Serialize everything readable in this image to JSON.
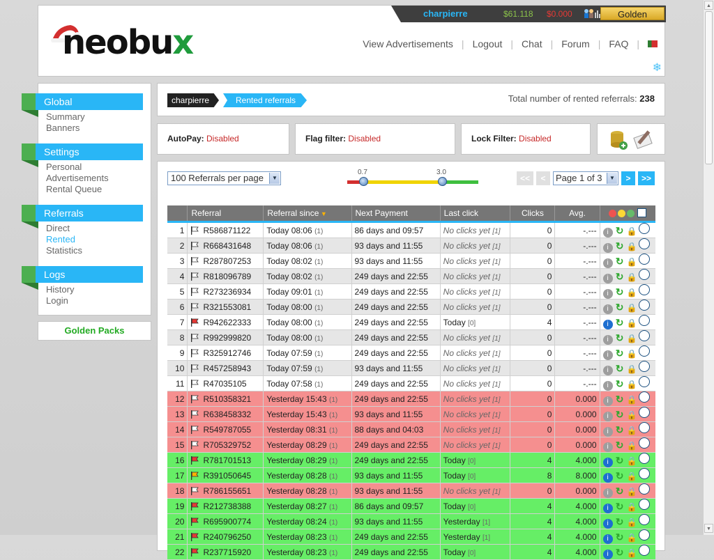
{
  "header": {
    "logo_text": "neobux",
    "username": "charpierre",
    "balance_main": "$61.118",
    "balance_rental": "$0.000",
    "membership_button": "Golden",
    "nav": [
      "View Advertisements",
      "Logout",
      "Chat",
      "Forum",
      "FAQ"
    ]
  },
  "sidebar": {
    "sections": [
      {
        "title": "Global",
        "links": [
          {
            "label": "Summary"
          },
          {
            "label": "Banners"
          }
        ]
      },
      {
        "title": "Settings",
        "links": [
          {
            "label": "Personal"
          },
          {
            "label": "Advertisements"
          },
          {
            "label": "Rental Queue"
          }
        ]
      },
      {
        "title": "Referrals",
        "links": [
          {
            "label": "Direct"
          },
          {
            "label": "Rented",
            "active": true
          },
          {
            "label": "Statistics"
          }
        ]
      },
      {
        "title": "Logs",
        "links": [
          {
            "label": "History"
          },
          {
            "label": "Login"
          }
        ]
      }
    ],
    "golden_packs": "Golden Packs"
  },
  "breadcrumb": {
    "user": "charpierre",
    "page": "Rented referrals"
  },
  "total": {
    "label": "Total number of rented referrals:",
    "value": "238"
  },
  "filters": {
    "autopay": {
      "label": "AutoPay:",
      "value": "Disabled"
    },
    "flag": {
      "label": "Flag filter:",
      "value": "Disabled"
    },
    "lock": {
      "label": "Lock Filter:",
      "value": "Disabled"
    }
  },
  "controls": {
    "per_page": "100 Referrals per page",
    "slider_min": "0.7",
    "slider_max": "3.0",
    "page_select": "Page 1 of 3",
    "first": "<<",
    "prev": "<",
    "next": ">",
    "last": ">>"
  },
  "table": {
    "columns": [
      "Referral",
      "Referral since",
      "Next Payment",
      "Last click",
      "Clicks",
      "Avg."
    ],
    "rows": [
      {
        "n": "1",
        "id": "R586871122",
        "since": "Today 08:06",
        "since_n": "(1)",
        "next": "86 days and 09:57",
        "last": "No clicks yet",
        "last_n": "[1]",
        "clicks": "0",
        "avg": "-.---",
        "color": "white",
        "flag": "white",
        "info": "gray"
      },
      {
        "n": "2",
        "id": "R668431648",
        "since": "Today 08:06",
        "since_n": "(1)",
        "next": "93 days and 11:55",
        "last": "No clicks yet",
        "last_n": "[1]",
        "clicks": "0",
        "avg": "-.---",
        "color": "gray",
        "flag": "white",
        "info": "gray"
      },
      {
        "n": "3",
        "id": "R287807253",
        "since": "Today 08:02",
        "since_n": "(1)",
        "next": "93 days and 11:55",
        "last": "No clicks yet",
        "last_n": "[1]",
        "clicks": "0",
        "avg": "-.---",
        "color": "white",
        "flag": "white",
        "info": "gray"
      },
      {
        "n": "4",
        "id": "R818096789",
        "since": "Today 08:02",
        "since_n": "(1)",
        "next": "249 days and 22:55",
        "last": "No clicks yet",
        "last_n": "[1]",
        "clicks": "0",
        "avg": "-.---",
        "color": "gray",
        "flag": "white",
        "info": "gray"
      },
      {
        "n": "5",
        "id": "R273236934",
        "since": "Today 09:01",
        "since_n": "(1)",
        "next": "249 days and 22:55",
        "last": "No clicks yet",
        "last_n": "[1]",
        "clicks": "0",
        "avg": "-.---",
        "color": "white",
        "flag": "white",
        "info": "gray"
      },
      {
        "n": "6",
        "id": "R321553081",
        "since": "Today 08:00",
        "since_n": "(1)",
        "next": "249 days and 22:55",
        "last": "No clicks yet",
        "last_n": "[1]",
        "clicks": "0",
        "avg": "-.---",
        "color": "gray",
        "flag": "white",
        "info": "gray"
      },
      {
        "n": "7",
        "id": "R942622333",
        "since": "Today 08:00",
        "since_n": "(1)",
        "next": "249 days and 22:55",
        "last": "Today",
        "last_n": "[0]",
        "clicks": "4",
        "avg": "-.---",
        "color": "white",
        "flag": "red",
        "info": "blue"
      },
      {
        "n": "8",
        "id": "R992999820",
        "since": "Today 08:00",
        "since_n": "(1)",
        "next": "249 days and 22:55",
        "last": "No clicks yet",
        "last_n": "[1]",
        "clicks": "0",
        "avg": "-.---",
        "color": "gray",
        "flag": "white",
        "info": "gray"
      },
      {
        "n": "9",
        "id": "R325912746",
        "since": "Today 07:59",
        "since_n": "(1)",
        "next": "249 days and 22:55",
        "last": "No clicks yet",
        "last_n": "[1]",
        "clicks": "0",
        "avg": "-.---",
        "color": "white",
        "flag": "white",
        "info": "gray"
      },
      {
        "n": "10",
        "id": "R457258943",
        "since": "Today 07:59",
        "since_n": "(1)",
        "next": "93 days and 11:55",
        "last": "No clicks yet",
        "last_n": "[1]",
        "clicks": "0",
        "avg": "-.---",
        "color": "gray",
        "flag": "white",
        "info": "gray"
      },
      {
        "n": "11",
        "id": "R47035105",
        "since": "Today 07:58",
        "since_n": "(1)",
        "next": "249 days and 22:55",
        "last": "No clicks yet",
        "last_n": "[1]",
        "clicks": "0",
        "avg": "-.---",
        "color": "white",
        "flag": "white",
        "info": "gray"
      },
      {
        "n": "12",
        "id": "R510358321",
        "since": "Yesterday 15:43",
        "since_n": "(1)",
        "next": "249 days and 22:55",
        "last": "No clicks yet",
        "last_n": "[1]",
        "clicks": "0",
        "avg": "0.000",
        "color": "red",
        "flag": "white",
        "info": "gray"
      },
      {
        "n": "13",
        "id": "R638458332",
        "since": "Yesterday 15:43",
        "since_n": "(1)",
        "next": "93 days and 11:55",
        "last": "No clicks yet",
        "last_n": "[1]",
        "clicks": "0",
        "avg": "0.000",
        "color": "red",
        "flag": "white",
        "info": "gray"
      },
      {
        "n": "14",
        "id": "R549787055",
        "since": "Yesterday 08:31",
        "since_n": "(1)",
        "next": "88 days and 04:03",
        "last": "No clicks yet",
        "last_n": "[1]",
        "clicks": "0",
        "avg": "0.000",
        "color": "red",
        "flag": "white",
        "info": "gray"
      },
      {
        "n": "15",
        "id": "R705329752",
        "since": "Yesterday 08:29",
        "since_n": "(1)",
        "next": "249 days and 22:55",
        "last": "No clicks yet",
        "last_n": "[1]",
        "clicks": "0",
        "avg": "0.000",
        "color": "red",
        "flag": "white",
        "info": "gray"
      },
      {
        "n": "16",
        "id": "R781701513",
        "since": "Yesterday 08:29",
        "since_n": "(1)",
        "next": "249 days and 22:55",
        "last": "Today",
        "last_n": "[0]",
        "clicks": "4",
        "avg": "4.000",
        "color": "green",
        "flag": "red",
        "info": "blue"
      },
      {
        "n": "17",
        "id": "R391050645",
        "since": "Yesterday 08:28",
        "since_n": "(1)",
        "next": "93 days and 11:55",
        "last": "Today",
        "last_n": "[0]",
        "clicks": "8",
        "avg": "8.000",
        "color": "green",
        "flag": "orange",
        "info": "blue"
      },
      {
        "n": "18",
        "id": "R786155651",
        "since": "Yesterday 08:28",
        "since_n": "(1)",
        "next": "93 days and 11:55",
        "last": "No clicks yet",
        "last_n": "[1]",
        "clicks": "0",
        "avg": "0.000",
        "color": "red",
        "flag": "white",
        "info": "gray"
      },
      {
        "n": "19",
        "id": "R212738388",
        "since": "Yesterday 08:27",
        "since_n": "(1)",
        "next": "86 days and 09:57",
        "last": "Today",
        "last_n": "[0]",
        "clicks": "4",
        "avg": "4.000",
        "color": "green",
        "flag": "red",
        "info": "blue"
      },
      {
        "n": "20",
        "id": "R695900774",
        "since": "Yesterday 08:24",
        "since_n": "(1)",
        "next": "93 days and 11:55",
        "last": "Yesterday",
        "last_n": "[1]",
        "clicks": "4",
        "avg": "4.000",
        "color": "green",
        "flag": "red",
        "info": "blue"
      },
      {
        "n": "21",
        "id": "R240796250",
        "since": "Yesterday 08:23",
        "since_n": "(1)",
        "next": "249 days and 22:55",
        "last": "Yesterday",
        "last_n": "[1]",
        "clicks": "4",
        "avg": "4.000",
        "color": "green",
        "flag": "red",
        "info": "blue"
      },
      {
        "n": "22",
        "id": "R237715920",
        "since": "Yesterday 08:23",
        "since_n": "(1)",
        "next": "249 days and 22:55",
        "last": "Today",
        "last_n": "[0]",
        "clicks": "4",
        "avg": "4.000",
        "color": "green",
        "flag": "red",
        "info": "blue"
      }
    ]
  },
  "colors": {
    "accent": "#29b6f6",
    "green": "#4caf50",
    "red_row": "#f58f8f",
    "green_row": "#66ee66"
  }
}
